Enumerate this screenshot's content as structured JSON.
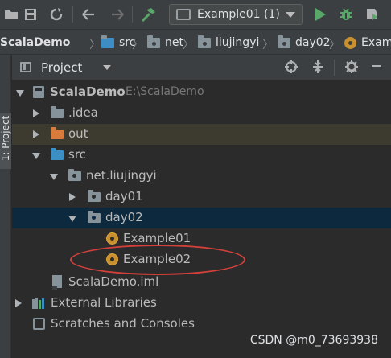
{
  "toolbar": {
    "run_config": "Example01 (1)",
    "icons": [
      "open-folder-icon",
      "save-icon",
      "refresh-icon",
      "back-icon",
      "forward-icon",
      "build-icon",
      "run-icon",
      "debug-icon",
      "coverage-icon"
    ]
  },
  "breadcrumb": [
    "ScalaDemo",
    "src",
    "net",
    "liujingyi",
    "day02",
    "Examp"
  ],
  "left_strip": {
    "label": "1: Project"
  },
  "panel": {
    "title": "Project"
  },
  "tree": {
    "root": {
      "label": "ScalaDemo",
      "path": "E:\\ScalaDemo"
    },
    "idea": ".idea",
    "out": "out",
    "src": "src",
    "pkg": "net.liujingyi",
    "day01": "day01",
    "day02": "day02",
    "example01": "Example01",
    "example02": "Example02",
    "iml": "ScalaDemo.iml",
    "ext_libs": "External Libraries",
    "scratches": "Scratches and Consoles"
  },
  "watermark": "CSDN @m0_73693938",
  "colors": {
    "background": "#2b2b2b",
    "toolbar": "#3c3f41",
    "selection": "#0d293e",
    "excluded_folder": "#d87b3c",
    "source_folder": "#3c8ec4",
    "scala_object": "#c8902f",
    "run_green": "#59a869",
    "annotation_red": "#d4403a"
  }
}
